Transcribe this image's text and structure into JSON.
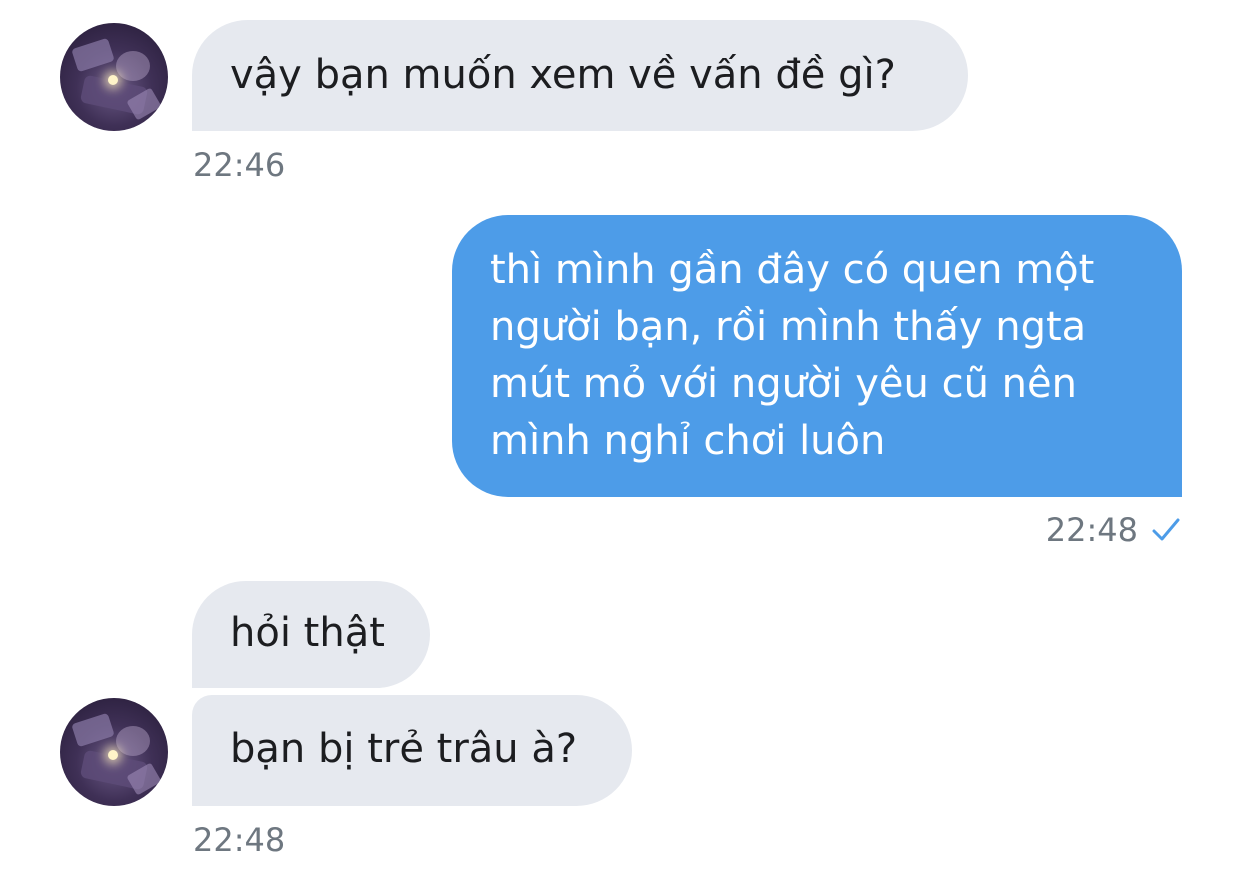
{
  "messages": [
    {
      "side": "in",
      "text": "vậy bạn muốn xem về vấn đề gì?",
      "time": "22:46"
    },
    {
      "side": "out",
      "lines": [
        "thì mình gần đây có quen một",
        "người bạn, rồi mình thấy ngta",
        "mút mỏ với người yêu cũ nên",
        "mình nghỉ chơi luôn"
      ],
      "time": "22:48",
      "status_icon": "checkmark-icon"
    },
    {
      "side": "in",
      "text": "hỏi thật"
    },
    {
      "side": "in",
      "text": "bạn bị trẻ trâu à?",
      "time": "22:48"
    }
  ],
  "colors": {
    "incoming_bubble": "#e6e9ef",
    "outgoing_bubble": "#4d9ce8",
    "timestamp": "#6e7780",
    "check": "#4d9ce8"
  }
}
